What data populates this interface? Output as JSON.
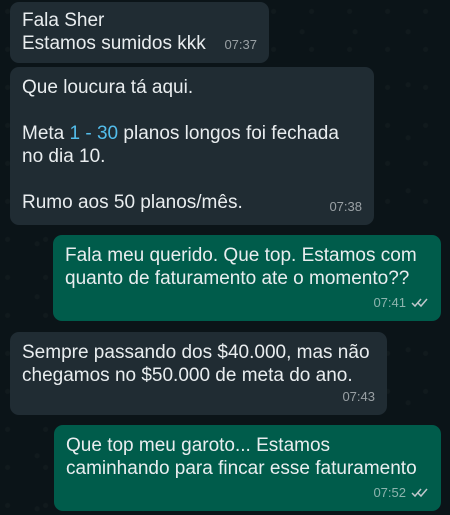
{
  "messages": [
    {
      "direction": "incoming",
      "text": "Fala Sher\nEstamos sumidos kkk",
      "time": "07:37"
    },
    {
      "direction": "incoming",
      "segments": [
        "Que loucura tá aqui.",
        "Meta ",
        "1 - 30",
        " planos longos foi fechada no dia 10.",
        "Rumo aos 50 planos/mês."
      ],
      "time": "07:38"
    },
    {
      "direction": "outgoing",
      "text": "Fala meu querido. Que top. Estamos com quanto de faturamento ate o momento??",
      "time": "07:41",
      "status": "read"
    },
    {
      "direction": "incoming",
      "text": "Sempre passando dos $40.000, mas não chegamos no $50.000 de meta do ano.",
      "time": "07:43"
    },
    {
      "direction": "outgoing",
      "text": "Que top meu garoto... Estamos caminhando para fincar esse faturamento",
      "time": "07:52",
      "status": "read"
    }
  ],
  "colors": {
    "incoming_bubble": "#202c33",
    "outgoing_bubble": "#005c4b",
    "link": "#53bdeb",
    "tick_read": "#c0c7cc"
  },
  "icons": {
    "read_receipt": "double-check-icon"
  }
}
